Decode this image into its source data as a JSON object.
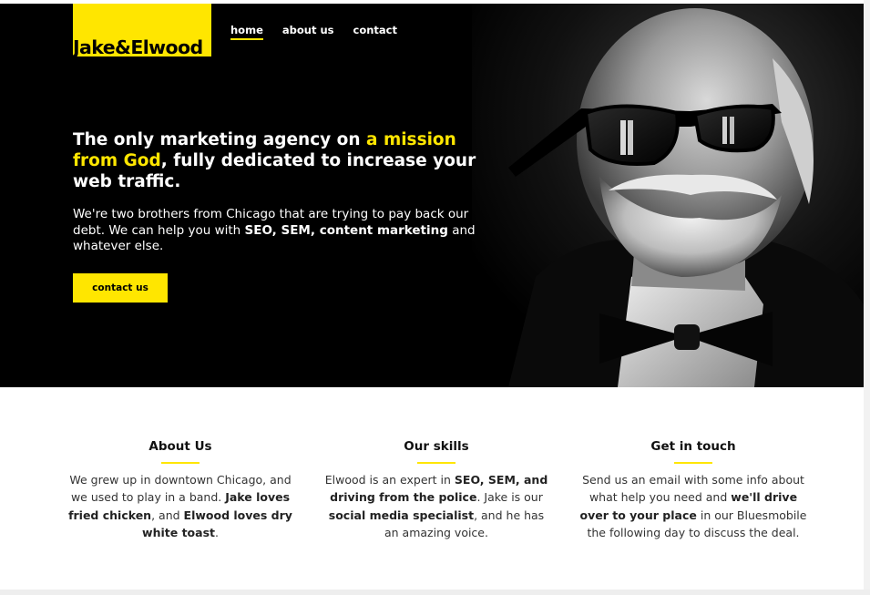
{
  "brand": {
    "logo_text": "Jake&Elwood",
    "accent": "#ffe600"
  },
  "nav": {
    "items": [
      {
        "label": "home",
        "active": true
      },
      {
        "label": "about us",
        "active": false
      },
      {
        "label": "contact",
        "active": false
      }
    ]
  },
  "hero": {
    "headline_part1": "The only marketing agency on ",
    "headline_highlight": "a mission from God",
    "headline_part2": ", fully dedicated to increase your web traffic.",
    "sub_part1": "We're two brothers from Chicago that are trying to pay back our debt. We can help you with ",
    "sub_bold": "SEO, SEM, content marketing",
    "sub_part2": " and whatever else.",
    "cta_label": "contact us"
  },
  "features": [
    {
      "title": "About Us",
      "t1": "We grew up in downtown Chicago, and we used to play in a band. ",
      "b1": "Jake loves fried chicken",
      "t2": ", and ",
      "b2": "Elwood loves dry white toast",
      "t3": "."
    },
    {
      "title": "Our skills",
      "t1": "Elwood is an expert in ",
      "b1": "SEO, SEM, and driving from the police",
      "t2": ". Jake is our ",
      "b2": "social media specialist",
      "t3": ", and he has an amazing voice."
    },
    {
      "title": "Get in touch",
      "t1": "Send us an email with some info about what help you need and ",
      "b1": "we'll drive over to your place",
      "t2": " in our Bluesmobile the following day to discuss the deal.",
      "b2": "",
      "t3": ""
    }
  ]
}
